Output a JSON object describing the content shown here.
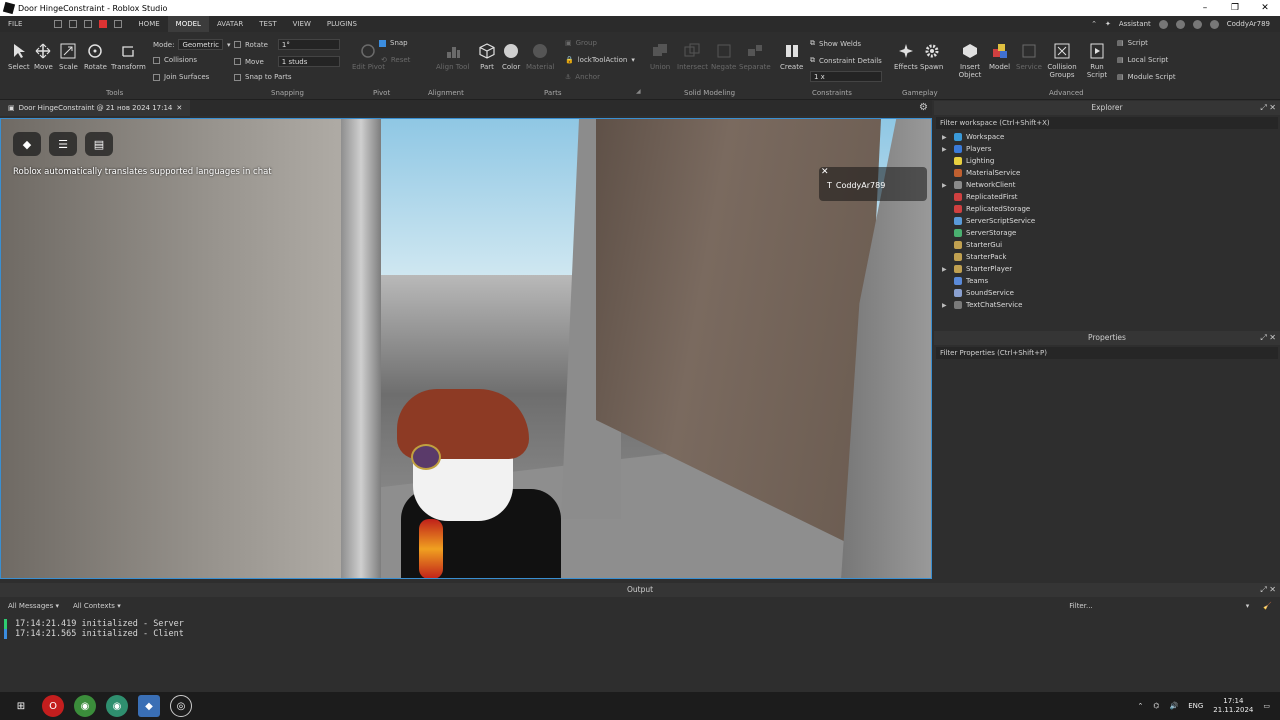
{
  "window": {
    "title": "Door HingeConstraint - Roblox Studio"
  },
  "menu": {
    "items": [
      "FILE",
      "HOME",
      "MODEL",
      "AVATAR",
      "TEST",
      "VIEW",
      "PLUGINS"
    ],
    "active": "MODEL",
    "assistant": "Assistant",
    "user": "CoddyAr789"
  },
  "ribbon": {
    "tools": {
      "select": "Select",
      "move": "Move",
      "scale": "Scale",
      "rotate": "Rotate",
      "transform": "Transform",
      "group": "Tools"
    },
    "mode": {
      "label": "Mode:",
      "value": "Geometric",
      "collisions": "Collisions",
      "join_surfaces": "Join Surfaces"
    },
    "snapping": {
      "rotate": "Rotate",
      "rotate_value": "1°",
      "move": "Move",
      "move_value": "1 studs",
      "snap_to_parts": "Snap to Parts",
      "group": "Snapping"
    },
    "pivot": {
      "snap": "Snap",
      "edit_pivot": "Edit Pivot",
      "reset": "Reset",
      "group": "Pivot"
    },
    "alignment": {
      "align_tool": "Align Tool",
      "group": "Alignment"
    },
    "parts": {
      "part": "Part",
      "color": "Color",
      "material": "Material",
      "group_btn": "Group",
      "lock": "lockToolAction",
      "anchor": "Anchor",
      "group": "Parts"
    },
    "solid": {
      "union": "Union",
      "intersect": "Intersect",
      "negate": "Negate",
      "separate": "Separate",
      "group": "Solid Modeling"
    },
    "constraints": {
      "create": "Create",
      "show_welds": "Show Welds",
      "constraint_details": "Constraint Details",
      "scale": "1 x",
      "group": "Constraints"
    },
    "gameplay": {
      "effects": "Effects",
      "spawn": "Spawn",
      "group": "Gameplay"
    },
    "advanced": {
      "insert_object": "Insert Object",
      "model": "Model",
      "service": "Service",
      "collision_groups": "Collision Groups",
      "run_script": "Run Script",
      "script": "Script",
      "local_script": "Local Script",
      "module_script": "Module Script",
      "group": "Advanced"
    }
  },
  "doc_tab": {
    "label": "Door HingeConstraint @ 21 нов 2024 17:14"
  },
  "viewport": {
    "message": "Roblox automatically translates supported languages in chat",
    "player": "CoddyAr789"
  },
  "explorer": {
    "title": "Explorer",
    "filter": "Filter workspace (Ctrl+Shift+X)",
    "items": [
      {
        "name": "Workspace",
        "expand": true,
        "color": "#3a9ad9"
      },
      {
        "name": "Players",
        "expand": true,
        "color": "#3a7ad9"
      },
      {
        "name": "Lighting",
        "expand": false,
        "color": "#e8d040"
      },
      {
        "name": "MaterialService",
        "expand": false,
        "color": "#c06030"
      },
      {
        "name": "NetworkClient",
        "expand": true,
        "color": "#8a8a8a"
      },
      {
        "name": "ReplicatedFirst",
        "expand": false,
        "color": "#cf4040"
      },
      {
        "name": "ReplicatedStorage",
        "expand": false,
        "color": "#cf4040"
      },
      {
        "name": "ServerScriptService",
        "expand": false,
        "color": "#5a9ad9"
      },
      {
        "name": "ServerStorage",
        "expand": false,
        "color": "#4ab070"
      },
      {
        "name": "StarterGui",
        "expand": false,
        "color": "#c0a050"
      },
      {
        "name": "StarterPack",
        "expand": false,
        "color": "#c0a050"
      },
      {
        "name": "StarterPlayer",
        "expand": true,
        "color": "#c0a050"
      },
      {
        "name": "Teams",
        "expand": false,
        "color": "#5a8ad9"
      },
      {
        "name": "SoundService",
        "expand": false,
        "color": "#8aa0d0"
      },
      {
        "name": "TextChatService",
        "expand": true,
        "color": "#7a7a7a"
      }
    ]
  },
  "properties": {
    "title": "Properties",
    "filter": "Filter Properties (Ctrl+Shift+P)"
  },
  "output": {
    "title": "Output",
    "messages": "All Messages",
    "contexts": "All Contexts",
    "filter": "Filter...",
    "lines": [
      {
        "time": "17:14:21.419",
        "text": "initialized  -  Server",
        "color": "#2ecc71"
      },
      {
        "time": "17:14:21.565",
        "text": "initialized  -  Client",
        "color": "#3b8ddf"
      }
    ]
  },
  "taskbar": {
    "lang": "ENG",
    "time": "17:14",
    "date": "21.11.2024"
  }
}
